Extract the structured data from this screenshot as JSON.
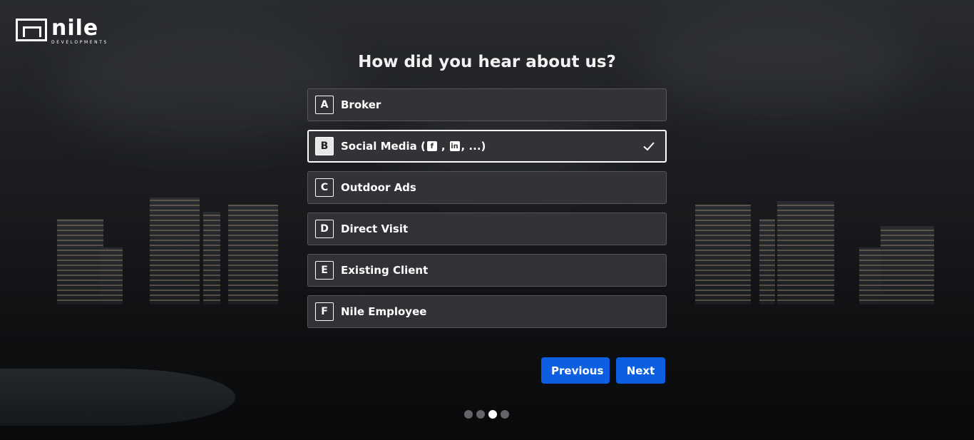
{
  "brand": {
    "name": "nile",
    "subtitle": "DEVELOPMENTS"
  },
  "question": "How did you hear about us?",
  "options": [
    {
      "key": "A",
      "label": "Broker",
      "selected": false
    },
    {
      "key": "B",
      "label": "Social Media (",
      "suffix": ", ...)",
      "selected": true,
      "icons": [
        "facebook-icon",
        "linkedin-icon"
      ]
    },
    {
      "key": "C",
      "label": "Outdoor Ads",
      "selected": false
    },
    {
      "key": "D",
      "label": "Direct Visit",
      "selected": false
    },
    {
      "key": "E",
      "label": "Existing Client",
      "selected": false
    },
    {
      "key": "F",
      "label": "Nile Employee",
      "selected": false
    }
  ],
  "buttons": {
    "previous": "Previous",
    "next": "Next"
  },
  "progress": {
    "total": 4,
    "current": 3
  },
  "colors": {
    "accent": "#0b5fe0",
    "option_bg": "#343438",
    "selected_border": "#ffffff"
  }
}
